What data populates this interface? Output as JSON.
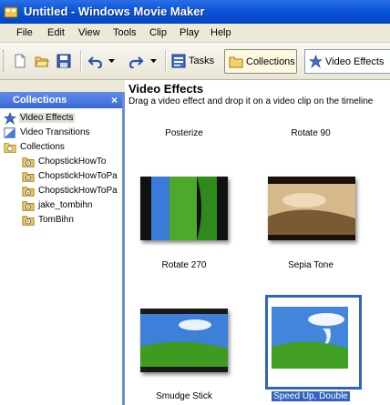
{
  "window": {
    "title": "Untitled - Windows Movie Maker"
  },
  "menu": [
    "File",
    "Edit",
    "View",
    "Tools",
    "Clip",
    "Play",
    "Help"
  ],
  "toolbar": {
    "tasks_label": "Tasks",
    "collections_label": "Collections",
    "effects_dropdown": "Video Effects"
  },
  "sidebar": {
    "header": "Collections",
    "close_glyph": "×",
    "items": [
      {
        "label": "Video Effects",
        "icon": "star-icon"
      },
      {
        "label": "Video Transitions",
        "icon": "transition-icon"
      },
      {
        "label": "Collections",
        "icon": "collections-folder-icon"
      },
      {
        "label": "ChopstickHowTo",
        "icon": "film-folder-icon"
      },
      {
        "label": "ChopstickHowToPa",
        "icon": "film-folder-icon"
      },
      {
        "label": "ChopstickHowToPa",
        "icon": "film-folder-icon"
      },
      {
        "label": "jake_tombihn",
        "icon": "film-folder-icon"
      },
      {
        "label": "TomBihn",
        "icon": "film-folder-icon"
      }
    ]
  },
  "main": {
    "title": "Video Effects",
    "description": "Drag a video effect and drop it on a video clip on the timeline",
    "effects": [
      {
        "label": "Posterize"
      },
      {
        "label": "Rotate 90"
      },
      {
        "label": "Rotate 270"
      },
      {
        "label": "Sepia Tone"
      },
      {
        "label": "Smudge Stick"
      },
      {
        "label": "Speed Up, Double"
      }
    ]
  },
  "colors": {
    "titlebar": "#0a55d8",
    "selection": "#3163c5",
    "pane_border": "#6b8fd6"
  }
}
